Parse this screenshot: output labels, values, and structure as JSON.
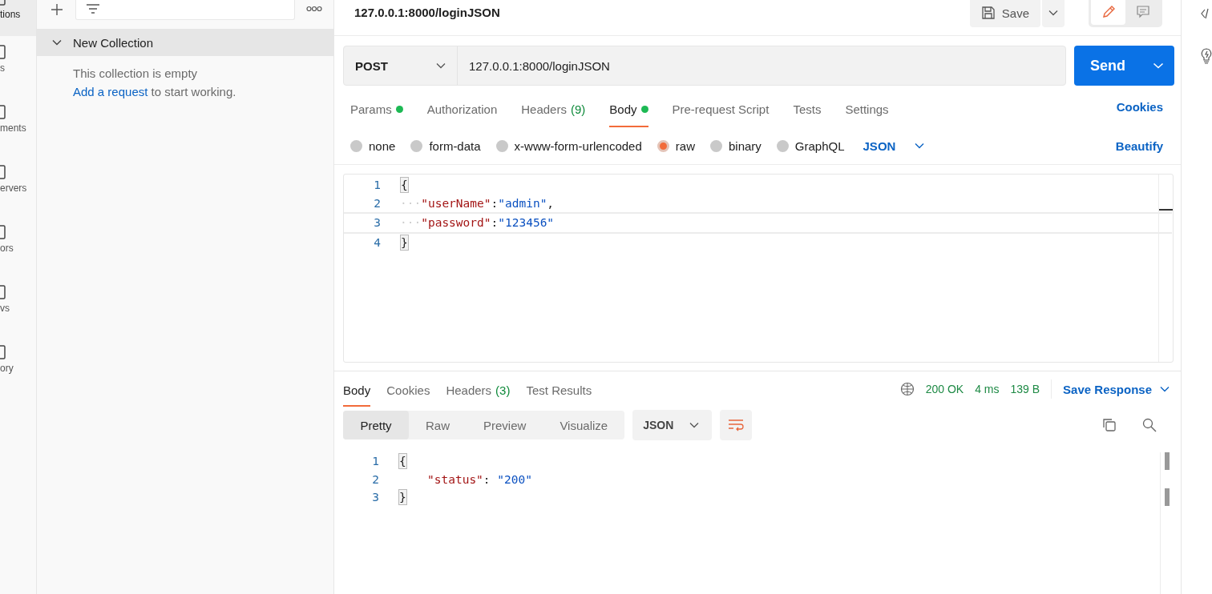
{
  "nav_rail": {
    "items": [
      {
        "label": "tions",
        "selected": true
      },
      {
        "label": "s",
        "selected": false
      },
      {
        "label": "ments",
        "selected": false
      },
      {
        "label": "ervers",
        "selected": false
      },
      {
        "label": "ors",
        "selected": false
      },
      {
        "label": "vs",
        "selected": false
      },
      {
        "label": "ory",
        "selected": false
      }
    ]
  },
  "sidebar": {
    "collection": {
      "name": "New Collection",
      "expanded": true
    },
    "empty_message": "This collection is empty",
    "add_link": "Add a request",
    "add_suffix": " to start working."
  },
  "request": {
    "title": "127.0.0.1:8000/loginJSON",
    "save_label": "Save",
    "method": "POST",
    "url": "127.0.0.1:8000/loginJSON",
    "send_label": "Send",
    "tabs": [
      {
        "label": "Params",
        "selected": false,
        "dot": true
      },
      {
        "label": "Authorization",
        "selected": false,
        "dot": false
      },
      {
        "label": "Headers",
        "count": "(9)",
        "selected": false,
        "dot": false
      },
      {
        "label": "Body",
        "selected": true,
        "dot": true
      },
      {
        "label": "Pre-request Script",
        "selected": false,
        "dot": false
      },
      {
        "label": "Tests",
        "selected": false,
        "dot": false
      },
      {
        "label": "Settings",
        "selected": false,
        "dot": false
      }
    ],
    "cookies_link": "Cookies",
    "body_types": [
      {
        "label": "none",
        "selected": false
      },
      {
        "label": "form-data",
        "selected": false
      },
      {
        "label": "x-www-form-urlencoded",
        "selected": false
      },
      {
        "label": "raw",
        "selected": true
      },
      {
        "label": "binary",
        "selected": false
      },
      {
        "label": "GraphQL",
        "selected": false
      }
    ],
    "language": "JSON",
    "beautify_link": "Beautify",
    "code": [
      {
        "number": "1",
        "active": false,
        "indented": false,
        "tokens": [
          {
            "kind": "brace",
            "text": "{"
          }
        ]
      },
      {
        "number": "2",
        "active": false,
        "indented": false,
        "tokens": [
          {
            "kind": "ws",
            "text": "···"
          },
          {
            "kind": "key",
            "text": "\"userName\""
          },
          {
            "kind": "punct",
            "text": ":"
          },
          {
            "kind": "str",
            "text": "\"admin\""
          },
          {
            "kind": "punct",
            "text": ","
          }
        ]
      },
      {
        "number": "3",
        "active": true,
        "indented": false,
        "tokens": [
          {
            "kind": "ws",
            "text": "···"
          },
          {
            "kind": "key",
            "text": "\"password\""
          },
          {
            "kind": "punct",
            "text": ":"
          },
          {
            "kind": "str",
            "text": "\"123456\""
          }
        ]
      },
      {
        "number": "4",
        "active": false,
        "indented": false,
        "tokens": [
          {
            "kind": "brace",
            "text": "}"
          }
        ]
      }
    ]
  },
  "response": {
    "tabs": [
      {
        "label": "Body",
        "selected": true
      },
      {
        "label": "Cookies",
        "selected": false
      },
      {
        "label": "Headers",
        "count": "(3)",
        "selected": false
      },
      {
        "label": "Test Results",
        "selected": false
      }
    ],
    "status": "200 OK",
    "time": "4 ms",
    "size": "139 B",
    "save_label": "Save Response",
    "views": [
      {
        "label": "Pretty",
        "selected": true
      },
      {
        "label": "Raw",
        "selected": false
      },
      {
        "label": "Preview",
        "selected": false
      },
      {
        "label": "Visualize",
        "selected": false
      }
    ],
    "language": "JSON",
    "code": [
      {
        "number": "1",
        "indented": false,
        "tokens": [
          {
            "kind": "brace",
            "text": "{"
          }
        ]
      },
      {
        "number": "2",
        "indented": true,
        "tokens": [
          {
            "kind": "key",
            "text": "\"status\""
          },
          {
            "kind": "punct",
            "text": ": "
          },
          {
            "kind": "str",
            "text": "\"200\""
          }
        ]
      },
      {
        "number": "3",
        "indented": false,
        "tokens": [
          {
            "kind": "brace",
            "text": "}"
          }
        ]
      }
    ]
  }
}
